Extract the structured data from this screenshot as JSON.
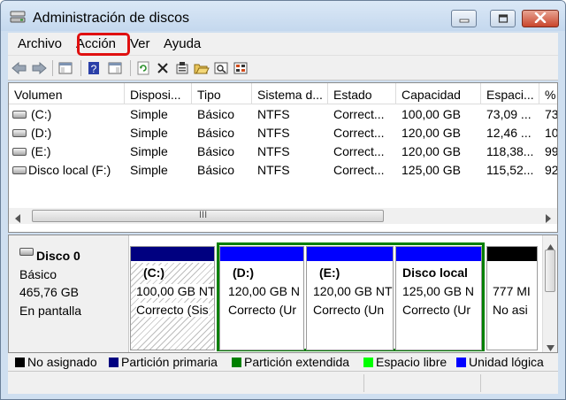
{
  "window": {
    "title": "Administración de discos"
  },
  "menu": [
    "Archivo",
    "Acción",
    "Ver",
    "Ayuda"
  ],
  "toolbar": {
    "buttons": [
      "back-icon",
      "forward-icon",
      "console-tree-icon",
      "help-icon",
      "show-hide-icon",
      "refresh-icon",
      "delete-icon",
      "properties-icon",
      "open-icon",
      "explore-icon",
      "settings-icon"
    ]
  },
  "volume_list": {
    "columns": [
      "Volumen",
      "Disposi...",
      "Tipo",
      "Sistema d...",
      "Estado",
      "Capacidad",
      "Espaci...",
      "%"
    ],
    "rows": [
      [
        "(C:)",
        "Simple",
        "Básico",
        "NTFS",
        "Correct...",
        "100,00 GB",
        "73,09 ...",
        "73"
      ],
      [
        "(D:)",
        "Simple",
        "Básico",
        "NTFS",
        "Correct...",
        "120,00 GB",
        "12,46 ...",
        "10"
      ],
      [
        "(E:)",
        "Simple",
        "Básico",
        "NTFS",
        "Correct...",
        "120,00 GB",
        "118,38...",
        "99"
      ],
      [
        "Disco local (F:)",
        "Simple",
        "Básico",
        "NTFS",
        "Correct...",
        "125,00 GB",
        "115,52...",
        "92"
      ]
    ],
    "scroll_thumb_label": "III"
  },
  "disk": {
    "name": "Disco 0",
    "type": "Básico",
    "size": "465,76 GB",
    "status": "En pantalla",
    "partitions": [
      {
        "label": "(C:)",
        "size": "100,00 GB NT",
        "status": "Correcto (Sis",
        "bar_color": "#000080",
        "kind": "primary"
      },
      {
        "label": "(D:)",
        "size": "120,00 GB N",
        "status": "Correcto (Ur",
        "bar_color": "#0000ff",
        "kind": "logical"
      },
      {
        "label": "(E:)",
        "size": "120,00 GB NT",
        "status": "Correcto (Un",
        "bar_color": "#0000ff",
        "kind": "logical"
      },
      {
        "label": "Disco local",
        "size": "125,00 GB N",
        "status": "Correcto (Ur",
        "bar_color": "#0000ff",
        "kind": "logical"
      },
      {
        "label": "",
        "size": "777 MI",
        "status": "No asi",
        "bar_color": "#000000",
        "kind": "unallocated"
      }
    ]
  },
  "legend": [
    {
      "label": "No asignado",
      "color": "#000000"
    },
    {
      "label": "Partición primaria",
      "color": "#000080"
    },
    {
      "label": "Partición extendida",
      "color": "#008000"
    },
    {
      "label": "Espacio libre",
      "color": "#00ff00"
    },
    {
      "label": "Unidad lógica",
      "color": "#0000ff"
    }
  ]
}
